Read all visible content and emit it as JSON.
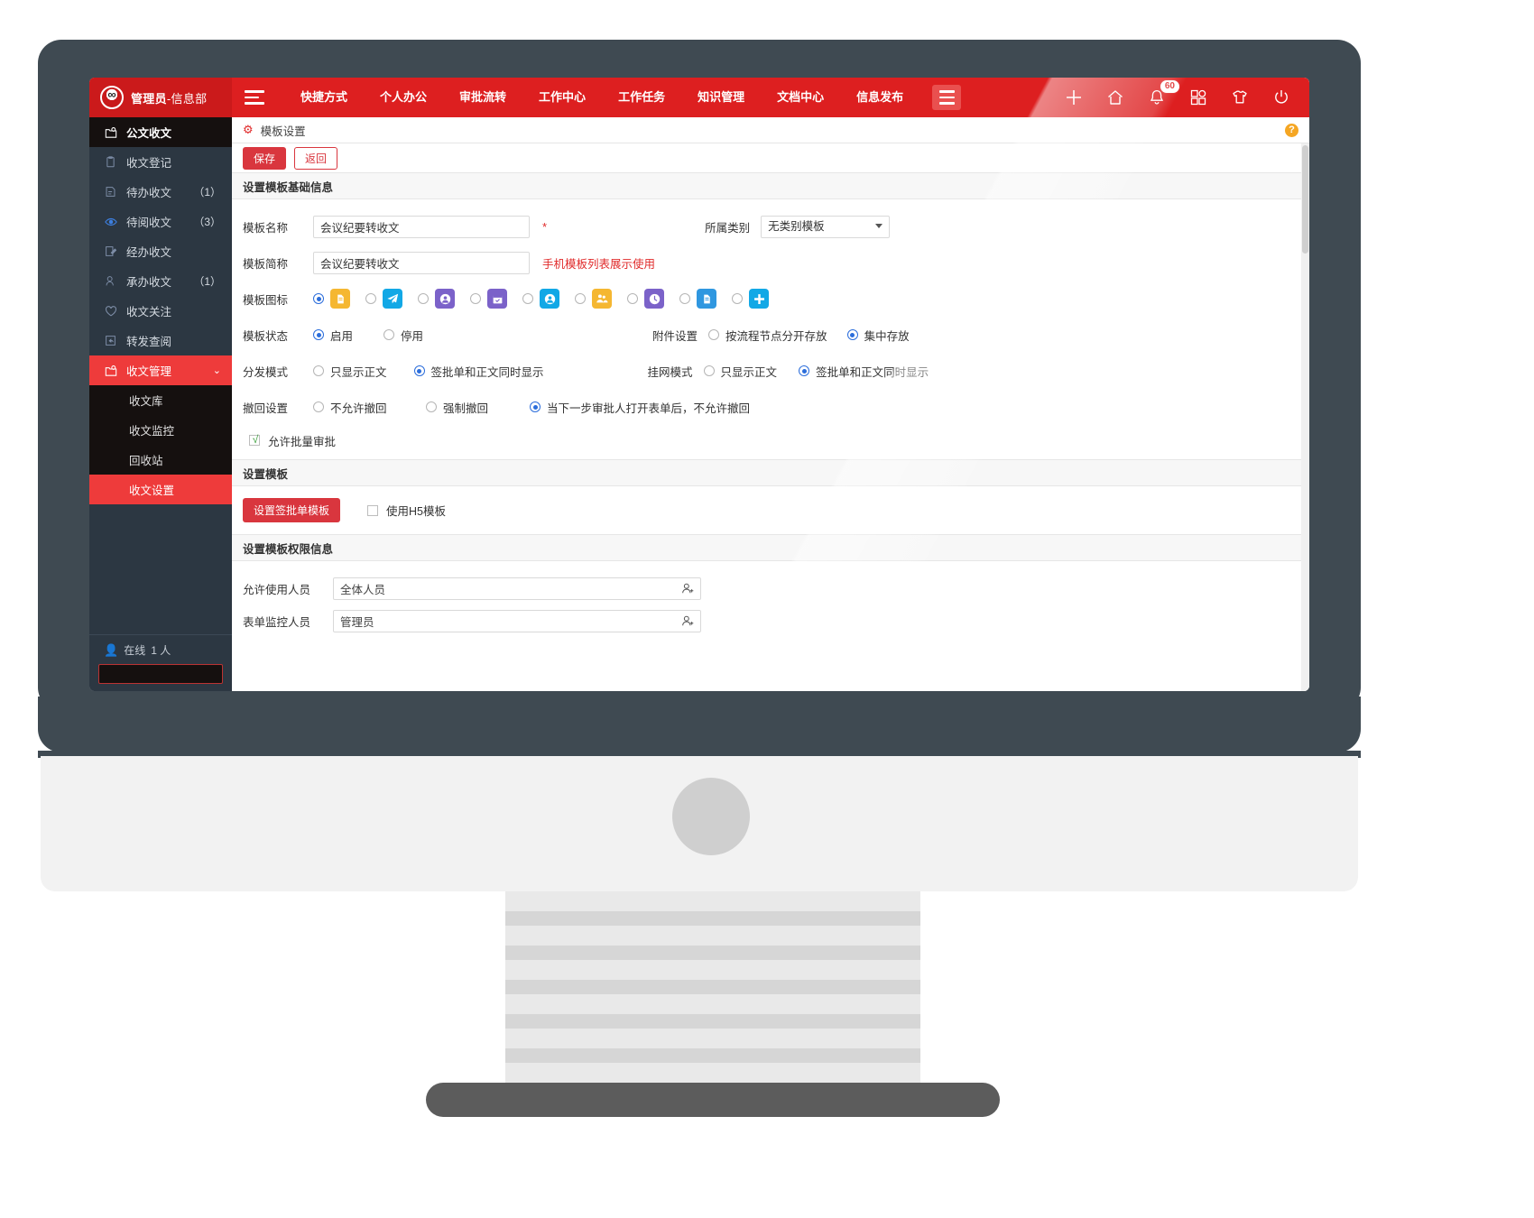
{
  "app": {
    "brand_user": "管理员",
    "brand_dept": "-信息部",
    "logo_text": "∞"
  },
  "nav": {
    "menu_icon": "hamburger-icon",
    "items": [
      {
        "label": "快捷方式"
      },
      {
        "label": "个人办公"
      },
      {
        "label": "审批流转"
      },
      {
        "label": "工作中心"
      },
      {
        "label": "工作任务"
      },
      {
        "label": "知识管理"
      },
      {
        "label": "文档中心"
      },
      {
        "label": "信息发布"
      }
    ],
    "more_icon": "more-menu-icon",
    "tools": [
      {
        "icon": "plus-icon",
        "name": "add"
      },
      {
        "icon": "home-icon",
        "name": "home"
      },
      {
        "icon": "bell-icon",
        "name": "notifications",
        "badge": "60"
      },
      {
        "icon": "apps-grid-icon",
        "name": "apps"
      },
      {
        "icon": "tshirt-icon",
        "name": "theme"
      },
      {
        "icon": "power-icon",
        "name": "logout"
      }
    ]
  },
  "sidebar": {
    "header": {
      "icon": "folder-doc-icon",
      "label": "公文收文"
    },
    "items": [
      {
        "icon": "clipboard-icon",
        "label": "收文登记",
        "count": ""
      },
      {
        "icon": "doc-edit-icon",
        "label": "待办收文",
        "count": "（1）"
      },
      {
        "icon": "eye-icon",
        "label": "待阅收文",
        "count": "（3）"
      },
      {
        "icon": "doc-pen-icon",
        "label": "经办收文",
        "count": ""
      },
      {
        "icon": "user-search-icon",
        "label": "承办收文",
        "count": "（1）"
      },
      {
        "icon": "heart-icon",
        "label": "收文关注",
        "count": ""
      },
      {
        "icon": "forward-icon",
        "label": "转发查阅",
        "count": ""
      },
      {
        "icon": "folder-gear-icon",
        "label": "收文管理",
        "count": "",
        "active": true,
        "expanded": true
      }
    ],
    "subitems": [
      {
        "label": "收文库",
        "active": false
      },
      {
        "label": "收文监控",
        "active": false
      },
      {
        "label": "回收站",
        "active": false
      },
      {
        "label": "收文设置",
        "active": true
      }
    ],
    "online_label": "在线",
    "online_count": "1 人",
    "search_value": "",
    "search_placeholder": ""
  },
  "breadcrumb": {
    "icon": "gear-icon",
    "title": "模板设置",
    "help_icon": "help-icon",
    "help_text": "?"
  },
  "toolbar": {
    "save_label": "保存",
    "back_label": "返回"
  },
  "sections": {
    "basic_title": "设置模板基础信息",
    "template_title": "设置模板",
    "permission_title": "设置模板权限信息"
  },
  "form": {
    "name_label": "模板名称",
    "name_value": "会议纪要转收文",
    "name_required": "*",
    "category_label": "所属类别",
    "category_value": "无类别模板",
    "short_label": "模板简称",
    "short_value": "会议纪要转收文",
    "short_hint": "手机模板列表展示使用",
    "icon_label": "模板图标",
    "icons": [
      {
        "name": "doc-yellow-icon",
        "bg": "#f5b731",
        "glyph": "doc",
        "selected": true
      },
      {
        "name": "plane-blue-icon",
        "bg": "#12a8e6",
        "glyph": "plane",
        "selected": false
      },
      {
        "name": "user-purple-icon",
        "bg": "#7b62c9",
        "glyph": "user",
        "selected": false
      },
      {
        "name": "calendar-check-purple-icon",
        "bg": "#7b62c9",
        "glyph": "calcheck",
        "selected": false
      },
      {
        "name": "user-blue-icon",
        "bg": "#12a8e6",
        "glyph": "user",
        "selected": false
      },
      {
        "name": "group-yellow-icon",
        "bg": "#f5b731",
        "glyph": "group",
        "selected": false
      },
      {
        "name": "clock-purple-icon",
        "bg": "#7b62c9",
        "glyph": "clock",
        "selected": false
      },
      {
        "name": "file-blue-icon",
        "bg": "#2f97e0",
        "glyph": "file",
        "selected": false
      },
      {
        "name": "plus-blue-icon",
        "bg": "#12a8e6",
        "glyph": "plus",
        "selected": false
      }
    ],
    "status_label": "模板状态",
    "status_options": [
      {
        "label": "启用",
        "selected": true
      },
      {
        "label": "停用",
        "selected": false
      }
    ],
    "attach_label": "附件设置",
    "attach_options": [
      {
        "label": "按流程节点分开存放",
        "selected": false
      },
      {
        "label": "集中存放",
        "selected": true
      }
    ],
    "distribute_label": "分发模式",
    "distribute_options": [
      {
        "label": "只显示正文",
        "selected": false
      },
      {
        "label": "签批单和正文同时显示",
        "selected": true
      }
    ],
    "web_label": "挂网模式",
    "web_options": [
      {
        "label": "只显示正文",
        "selected": false
      },
      {
        "label": "签批单和正文同时显示",
        "selected": true
      }
    ],
    "revoke_label": "撤回设置",
    "revoke_options": [
      {
        "label": "不允许撤回",
        "selected": false
      },
      {
        "label": "强制撤回",
        "selected": false
      },
      {
        "label": "当下一步审批人打开表单后，不允许撤回",
        "selected": true
      }
    ],
    "batch_label": "允许批量审批",
    "batch_checked": true,
    "set_form_button": "设置签批单模板",
    "h5_label": "使用H5模板",
    "h5_checked": false,
    "allow_users_label": "允许使用人员",
    "allow_users_value": "全体人员",
    "monitor_label": "表单监控人员",
    "monitor_value": "管理员"
  },
  "colors": {
    "brand_red": "#dd1f20",
    "sidebar_dark": "#2c3742",
    "sidebar_black": "#15100f",
    "active_red": "#ee3b3b",
    "radio_blue": "#2b6ddb"
  }
}
